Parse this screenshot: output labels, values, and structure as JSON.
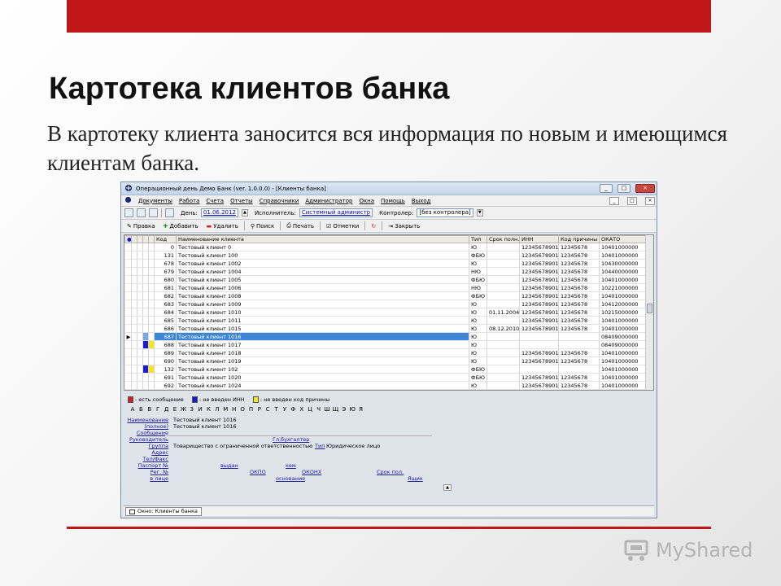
{
  "slide": {
    "title": "Картотека клиентов банка",
    "text": "В картотеку клиента заносится вся информация по новым и имеющимся клиентам банка.",
    "logo": "MyShared"
  },
  "colors": {
    "accent": "#c0181a",
    "selection": "#3d86d6",
    "marker_blue": "#1b1bd0",
    "marker_yellow": "#f5e61e"
  },
  "app": {
    "title": "Операционный день Демо Банк (ver. 1.0.0.0) - [Клиенты банка]",
    "window_buttons": [
      "_",
      "□",
      "×"
    ],
    "menu": [
      "Документы",
      "Работа",
      "Счета",
      "Отчеты",
      "Справочники",
      "Администратор",
      "Окна",
      "Помощь",
      "Выход"
    ],
    "toolbar1": {
      "day_label": "День:",
      "day_value": "01.06.2012",
      "executor_label": "Исполнитель:",
      "executor_value": "Системный администр",
      "controller_label": "Контролер:",
      "controller_value": "[без контролера]"
    },
    "toolbar2": [
      "Правка",
      "Добавить",
      "Удалить",
      "Поиск",
      "Печать",
      "Отметки",
      "Закрыть"
    ],
    "grid": {
      "columns": [
        "Код",
        "Наименование клиента",
        "Тип",
        "Срок полн.",
        "ИНН",
        "Код причины",
        "ОКАТО"
      ],
      "rows": [
        [
          "0",
          "Тестовый клиент 0",
          "Ю",
          "",
          "12345678901",
          "12345678",
          "10401000000"
        ],
        [
          "131",
          "Тестовый клиент 100",
          "ФБЮ",
          "",
          "12345678901",
          "12345678",
          "10401000000"
        ],
        [
          "678",
          "Тестовый клиент 1002",
          "Ю",
          "",
          "12345678901",
          "12345678",
          "10430000000"
        ],
        [
          "679",
          "Тестовый клиент 1004",
          "НЮ",
          "",
          "12345678901",
          "12345678",
          "10440000000"
        ],
        [
          "680",
          "Тестовый клиент 1005",
          "ФБЮ",
          "",
          "12345678901",
          "12345678",
          "10401000000"
        ],
        [
          "681",
          "Тестовый клиент 1006",
          "НЮ",
          "",
          "12345678901",
          "12345678",
          "10221000000"
        ],
        [
          "682",
          "Тестовый клиент 1008",
          "ФБЮ",
          "",
          "12345678901",
          "12345678",
          "10401000000"
        ],
        [
          "683",
          "Тестовый клиент 1009",
          "Ю",
          "",
          "12345678901",
          "12345678",
          "10412000000"
        ],
        [
          "684",
          "Тестовый клиент 1010",
          "Ю",
          "01.11.2004",
          "12345678901",
          "12345678",
          "10215000000"
        ],
        [
          "685",
          "Тестовый клиент 1011",
          "Ю",
          "",
          "12345678901",
          "12345678",
          "10401000000"
        ],
        [
          "686",
          "Тестовый клиент 1015",
          "Ю",
          "08.12.2010",
          "12345678901",
          "12345678",
          "10401000000"
        ],
        [
          "687",
          "Тестовый клиент 1016",
          "Ю",
          "",
          "",
          "",
          "08409000000"
        ],
        [
          "688",
          "Тестовый клиент 1017",
          "Ю",
          "",
          "",
          "",
          "08409000000"
        ],
        [
          "689",
          "Тестовый клиент 1018",
          "Ю",
          "",
          "12345678901",
          "12345678",
          "10401000000"
        ],
        [
          "690",
          "Тестовый клиент 1019",
          "Ю",
          "",
          "12345678901",
          "12345678",
          "10401000000"
        ],
        [
          "132",
          "Тестовый клиент 102",
          "ФБЮ",
          "",
          "",
          "",
          "10401000000"
        ],
        [
          "691",
          "Тестовый клиент 1020",
          "ФБЮ",
          "",
          "12345678901",
          "12345678",
          "10401000000"
        ],
        [
          "692",
          "Тестовый клиент 1024",
          "Ю",
          "",
          "12345678901",
          "12345678",
          "10401000000"
        ]
      ]
    },
    "legend": [
      "- есть сообщение",
      "- не введен ИНН",
      "- не введен код причины"
    ],
    "alphabet": [
      "А",
      "Б",
      "В",
      "Г",
      "Д",
      "Е",
      "Ж",
      "З",
      "И",
      "К",
      "Л",
      "М",
      "Н",
      "О",
      "П",
      "Р",
      "С",
      "Т",
      "У",
      "Ф",
      "Х",
      "Ц",
      "Ч",
      "Ш",
      "Щ",
      "Э",
      "Ю",
      "Я"
    ],
    "details": {
      "name_label": "Наименование",
      "name_value": "Тестовый клиент 1016",
      "full_label": "(полное)",
      "full_value": "Тестовый клиент 1016",
      "message_label": "Сообщение",
      "head_label": "Руководитель",
      "accountant_label": "Гл.бухгалтер",
      "group_label": "Группа",
      "group_value": "Товарищество с ограниченной ответственностью",
      "type_label": "Тип",
      "type_value": "Юридическое лицо",
      "address_label": "Адрес",
      "phone_label": "Тел/Факс",
      "passport_label": "Паспорт №",
      "issued_label": "выдан",
      "by_whom_label": "кем",
      "reg_label": "Рег. №",
      "okpo_label": "ОКПО",
      "okonh_label": "ОКОНХ",
      "term_label": "Срок пол.",
      "person_label": "в лице",
      "basis_label": "основание",
      "box_label": "Ящик"
    },
    "status_tab": "Окно: Клиенты банка"
  }
}
